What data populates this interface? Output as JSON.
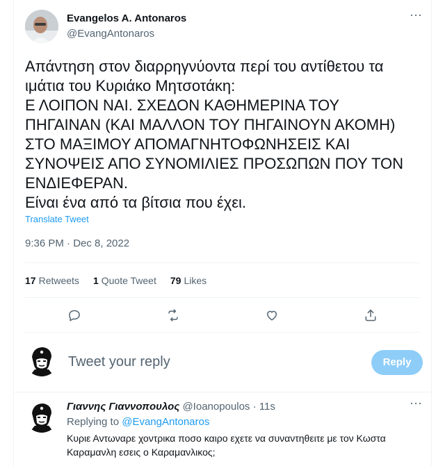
{
  "tweet": {
    "author_name": "Evangelos A. Antonaros",
    "author_handle": "@EvangAntonaros",
    "text": "Απάντηση στον διαρρηγνύοντα περί του αντίθετου τα\nιμάτια του Κυριάκο Μητσοτάκη:\nΕ ΛΟΙΠΟΝ ΝΑΙ. ΣΧΕΔΟΝ ΚΑΘΗΜΕΡΙΝΑ ΤΟΥ\nΠΗΓΑΙΝΑΝ (ΚΑΙ ΜΑΛΛΟΝ ΤΟΥ ΠΗΓΑΙΝΟΥΝ ΑΚΟΜΗ)\nΣΤΟ ΜΑΞΙΜΟΥ ΑΠΟΜΑΓΝΗΤΟΦΩΝΗΣΕΙΣ ΚΑΙ\nΣΥΝΟΨΕΙΣ ΑΠΟ ΣΥΝΟΜΙΛΙΕΣ ΠΡΟΣΩΠΩΝ ΠΟΥ ΤΟΝ\nΕΝΔΙΕΦΕΡΑΝ.\nΕίναι ένα από τα βίτσια που έχει.",
    "translate_label": "Translate Tweet",
    "timestamp": "9:36 PM · Dec 8, 2022",
    "stats": {
      "retweets_count": "17",
      "retweets_label": "Retweets",
      "quotes_count": "1",
      "quotes_label": "Quote Tweet",
      "likes_count": "79",
      "likes_label": "Likes"
    },
    "actions": [
      "reply-icon",
      "retweet-icon",
      "like-icon",
      "share-icon"
    ]
  },
  "reply_box": {
    "placeholder": "Tweet your reply",
    "button_label": "Reply"
  },
  "comment": {
    "name": "Γιαννης Γιαννοπουλος",
    "handle": "@Ioanopoulos",
    "separator": "·",
    "time": "11s",
    "replying_prefix": "Replying to",
    "replying_handle": "@EvangAntonaros",
    "text": "Κυριε Αντωναρε χοντρικα ποσο καιρο εχετε να συναντηθειτε με τον Κωστα Καραμανλη εσεις ο Καραμανλικος;"
  },
  "colors": {
    "accent": "#1d9bf0",
    "muted": "#536471",
    "reply_button_disabled": "#8ecdf8"
  }
}
